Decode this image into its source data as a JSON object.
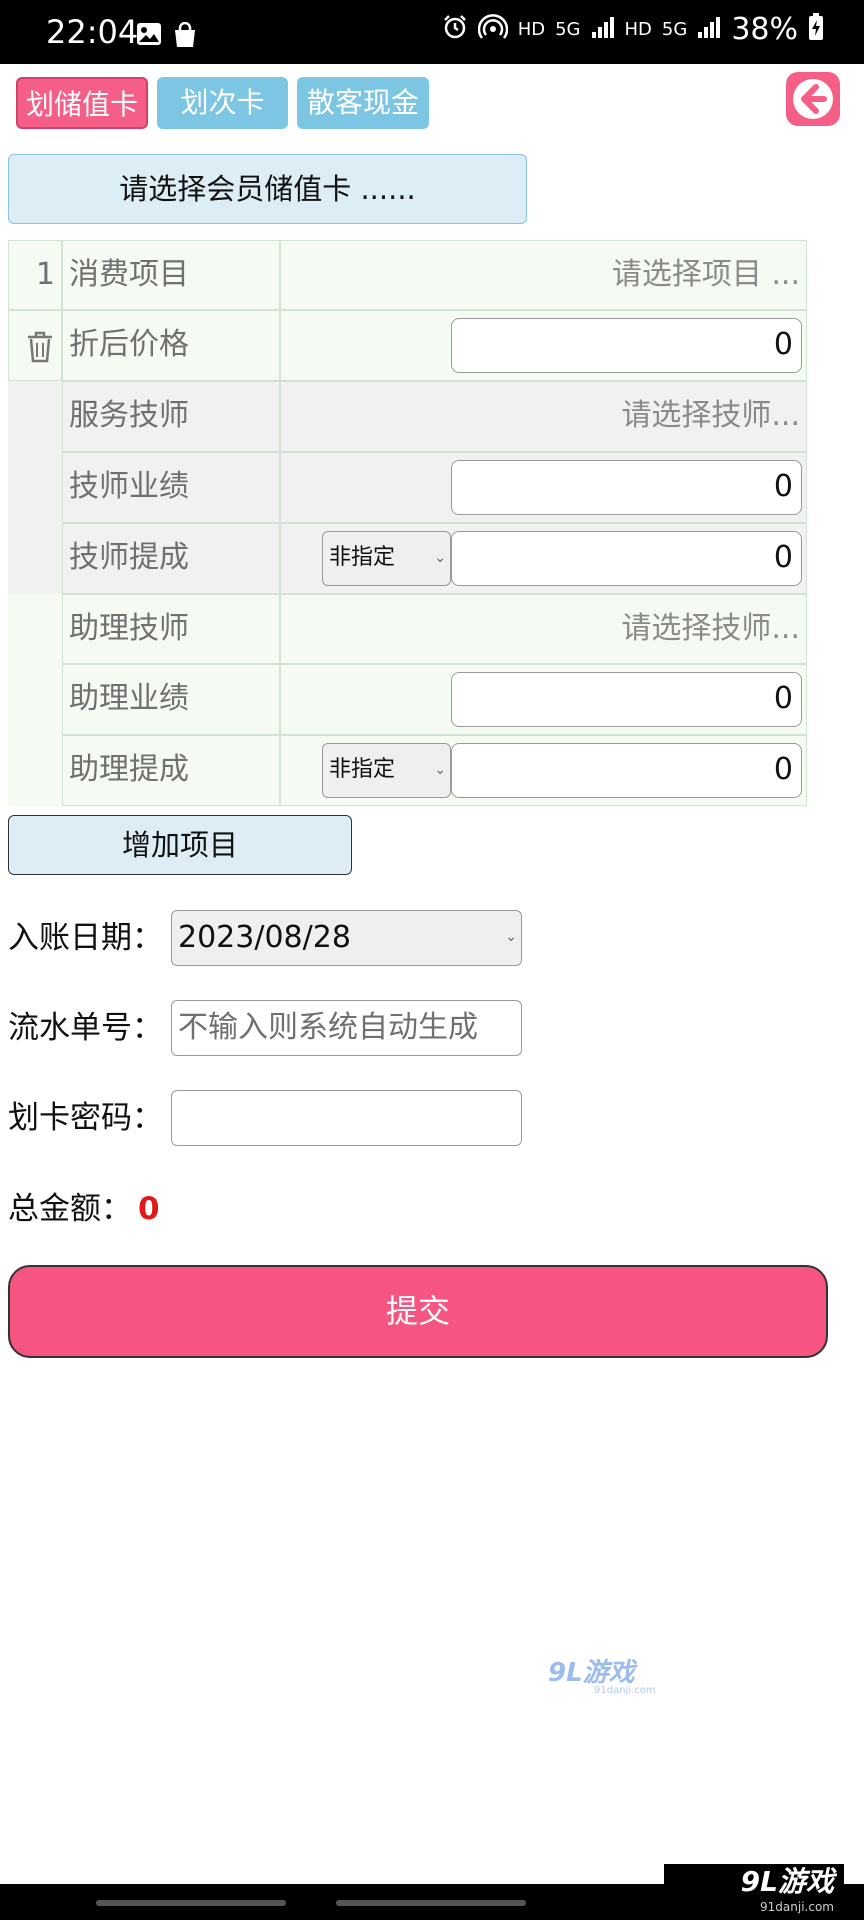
{
  "status_bar": {
    "time": "22:04",
    "net_hd_1": "HD",
    "net_5g_1": "5G",
    "net_hd_2": "HD",
    "net_5g_2": "5G",
    "battery": "38%"
  },
  "tabs": [
    {
      "label": "划储值卡",
      "active": true
    },
    {
      "label": "划次卡",
      "active": false
    },
    {
      "label": "散客现金",
      "active": false
    }
  ],
  "member_select": {
    "label": "请选择会员储值卡 ......"
  },
  "item": {
    "index": "1",
    "rows": {
      "project": {
        "label": "消费项目",
        "value": "请选择项目 ..."
      },
      "price": {
        "label": "折后价格",
        "value": "0"
      },
      "tech": {
        "label": "服务技师",
        "value": "请选择技师..."
      },
      "tech_perf": {
        "label": "技师业绩",
        "value": "0"
      },
      "tech_comm": {
        "label": "技师提成",
        "mode": "非指定",
        "value": "0"
      },
      "assist": {
        "label": "助理技师",
        "value": "请选择技师..."
      },
      "assist_perf": {
        "label": "助理业绩",
        "value": "0"
      },
      "assist_comm": {
        "label": "助理提成",
        "mode": "非指定",
        "value": "0"
      }
    }
  },
  "add_item": {
    "label": "增加项目"
  },
  "fields": {
    "date": {
      "label": "入账日期：",
      "value": "2023/08/28"
    },
    "serial": {
      "label": "流水单号：",
      "placeholder": "不输入则系统自动生成"
    },
    "password": {
      "label": "划卡密码：",
      "value": ""
    }
  },
  "total": {
    "label": "总金额：",
    "value": "0"
  },
  "submit": {
    "label": "提交"
  },
  "watermarks": {
    "center_logo": "9L游戏",
    "center_url": "91danji.com",
    "corner_logo": "9L游戏",
    "corner_url": "91danji.com"
  },
  "colors": {
    "accent_pink": "#f55e86",
    "tab_blue": "#7cc6e3",
    "light_blue": "#dcedf5",
    "total_red": "#e01a1a"
  }
}
